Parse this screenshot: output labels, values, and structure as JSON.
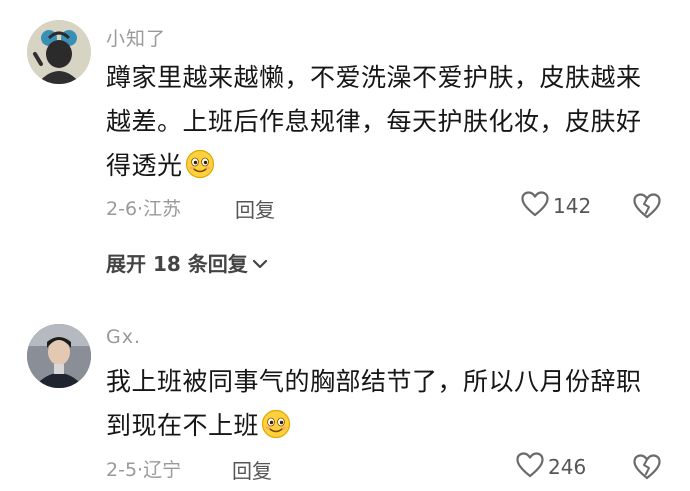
{
  "comments": [
    {
      "author": "小知了",
      "text": "蹲家里越来越懒，不爱洗澡不爱护肤，皮肤越来越差。上班后作息规律，每天护肤化妆，皮肤好得透光",
      "emoji_icon": "smiling-face-emoji-icon",
      "date": "2-6",
      "separator": "·",
      "location": "江苏",
      "reply_label": "回复",
      "like_count": "142",
      "expand_label": "展开 18 条回复"
    },
    {
      "author": "Gx.",
      "text": "我上班被同事气的胸部结节了，所以八月份辞职到现在不上班",
      "emoji_icon": "smiling-face-emoji-icon",
      "date": "2-5",
      "separator": "·",
      "location": "辽宁",
      "reply_label": "回复",
      "like_count": "246"
    }
  ],
  "colors": {
    "meta_gray": "#9a9a9a",
    "text_dark": "#161616",
    "avatar1_bg": "#d9d6c7",
    "avatar2_bg": "#6b6f78"
  },
  "icons": {
    "like": "heart-outline-icon",
    "dislike": "broken-heart-icon",
    "expand": "chevron-down-icon"
  }
}
